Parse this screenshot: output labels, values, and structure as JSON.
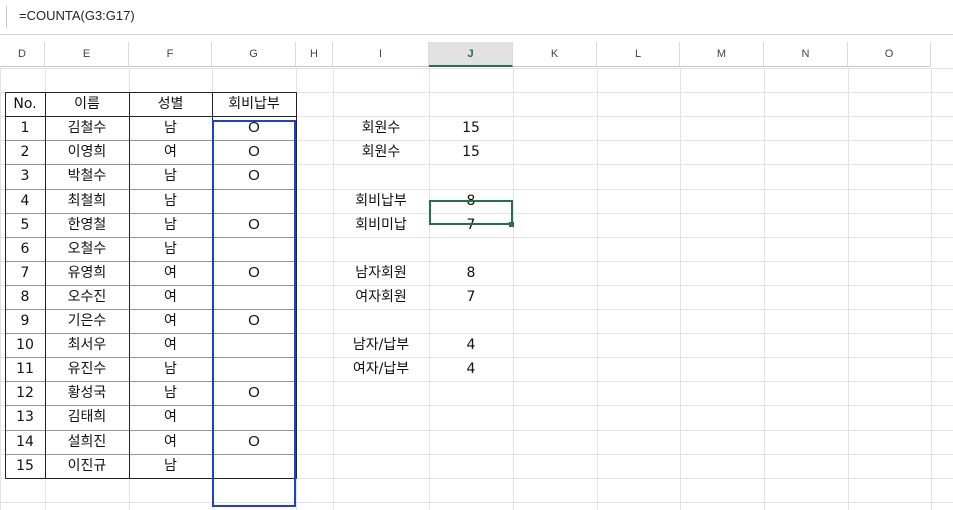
{
  "formula_bar": {
    "formula": "=COUNTA(G3:G17)"
  },
  "columns": [
    "D",
    "E",
    "F",
    "G",
    "H",
    "I",
    "J",
    "K",
    "L",
    "M",
    "N",
    "O"
  ],
  "selected_column": "J",
  "colors": {
    "selection_green": "#217346",
    "range_blue": "#1f3fd1"
  },
  "table": {
    "headers": [
      "No.",
      "이름",
      "성별",
      "회비납부"
    ],
    "rows": [
      {
        "no": "1",
        "name": "김철수",
        "gender": "남",
        "paid": "O"
      },
      {
        "no": "2",
        "name": "이영희",
        "gender": "여",
        "paid": "O"
      },
      {
        "no": "3",
        "name": "박철수",
        "gender": "남",
        "paid": "O"
      },
      {
        "no": "4",
        "name": "최철희",
        "gender": "남",
        "paid": ""
      },
      {
        "no": "5",
        "name": "한영철",
        "gender": "남",
        "paid": "O"
      },
      {
        "no": "6",
        "name": "오철수",
        "gender": "남",
        "paid": ""
      },
      {
        "no": "7",
        "name": "유영희",
        "gender": "여",
        "paid": "O"
      },
      {
        "no": "8",
        "name": "오수진",
        "gender": "여",
        "paid": ""
      },
      {
        "no": "9",
        "name": "기은수",
        "gender": "여",
        "paid": "O"
      },
      {
        "no": "10",
        "name": "최서우",
        "gender": "여",
        "paid": ""
      },
      {
        "no": "11",
        "name": "유진수",
        "gender": "남",
        "paid": ""
      },
      {
        "no": "12",
        "name": "황성국",
        "gender": "남",
        "paid": "O"
      },
      {
        "no": "13",
        "name": "김태희",
        "gender": "여",
        "paid": ""
      },
      {
        "no": "14",
        "name": "설희진",
        "gender": "여",
        "paid": "O"
      },
      {
        "no": "15",
        "name": "이진규",
        "gender": "남",
        "paid": ""
      }
    ]
  },
  "summary": [
    {
      "label": "회원수",
      "value": "15",
      "row": 0
    },
    {
      "label": "회원수",
      "value": "15",
      "row": 1
    },
    {
      "label": "회비납부",
      "value": "8",
      "row": 3,
      "selected": true
    },
    {
      "label": "회비미납",
      "value": "7",
      "row": 4
    },
    {
      "label": "남자회원",
      "value": "8",
      "row": 6
    },
    {
      "label": "여자회원",
      "value": "7",
      "row": 7
    },
    {
      "label": "남자/납부",
      "value": "4",
      "row": 9
    },
    {
      "label": "여자/납부",
      "value": "4",
      "row": 10
    }
  ]
}
